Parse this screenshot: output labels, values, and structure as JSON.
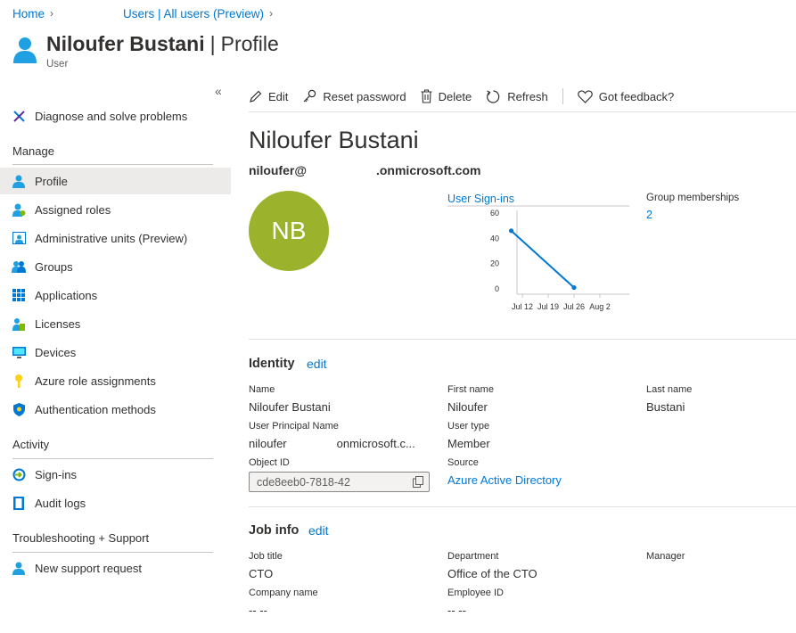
{
  "breadcrumb": [
    "Home",
    "Users | All users (Preview)"
  ],
  "header": {
    "name": "Niloufer Bustani",
    "page": "Profile",
    "subtitle": "User"
  },
  "sidebar": {
    "collapse_glyph": "«",
    "top_items": [
      {
        "label": "Diagnose and solve problems",
        "icon": "wrench-icon"
      }
    ],
    "sections": [
      {
        "title": "Manage",
        "items": [
          {
            "label": "Profile",
            "icon": "user-icon"
          },
          {
            "label": "Assigned roles",
            "icon": "assigned-roles-icon"
          },
          {
            "label": "Administrative units (Preview)",
            "icon": "admin-units-icon"
          },
          {
            "label": "Groups",
            "icon": "groups-icon"
          },
          {
            "label": "Applications",
            "icon": "grid-icon"
          },
          {
            "label": "Licenses",
            "icon": "license-icon"
          },
          {
            "label": "Devices",
            "icon": "monitor-icon"
          },
          {
            "label": "Azure role assignments",
            "icon": "key-icon"
          },
          {
            "label": "Authentication methods",
            "icon": "shield-icon"
          }
        ]
      },
      {
        "title": "Activity",
        "items": [
          {
            "label": "Sign-ins",
            "icon": "signin-icon"
          },
          {
            "label": "Audit logs",
            "icon": "book-icon"
          }
        ]
      },
      {
        "title": "Troubleshooting + Support",
        "items": [
          {
            "label": "New support request",
            "icon": "support-user-icon"
          }
        ]
      }
    ]
  },
  "toolbar": {
    "edit": "Edit",
    "reset_password": "Reset password",
    "delete": "Delete",
    "refresh": "Refresh",
    "feedback": "Got feedback?"
  },
  "profile": {
    "display_name": "Niloufer Bustani",
    "upn_prefix": "niloufer@",
    "upn_suffix": ".onmicrosoft.com",
    "initials": "NB",
    "avatar_color": "#9bb32c"
  },
  "signins_chart": {
    "title": "User Sign-ins",
    "chart_data": {
      "type": "line",
      "x_ticks": [
        "Jul 12",
        "Jul 19",
        "Jul 26",
        "Aug 2"
      ],
      "y_ticks": [
        0,
        20,
        40,
        60
      ],
      "ylim": [
        0,
        60
      ],
      "series": [
        {
          "points": [
            {
              "x": "Jul 9",
              "y": 46
            },
            {
              "x": "Jul 26",
              "y": 1
            }
          ]
        }
      ]
    },
    "line_color": "#0078d4"
  },
  "group_memberships": {
    "label": "Group memberships",
    "value": "2"
  },
  "identity": {
    "title": "Identity",
    "edit": "edit",
    "name_label": "Name",
    "name_value": "Niloufer Bustani",
    "first_label": "First name",
    "first_value": "Niloufer",
    "last_label": "Last name",
    "last_value": "Bustani",
    "upn_label": "User Principal Name",
    "upn_value_start": "niloufer",
    "upn_value_end": "onmicrosoft.c...",
    "type_label": "User type",
    "type_value": "Member",
    "objid_label": "Object ID",
    "objid_value": "cde8eeb0-7818-42",
    "source_label": "Source",
    "source_value": "Azure Active Directory"
  },
  "job": {
    "title": "Job info",
    "edit": "edit",
    "jobtitle_label": "Job title",
    "jobtitle_value": "CTO",
    "dept_label": "Department",
    "dept_value": "Office of the CTO",
    "manager_label": "Manager",
    "company_label": "Company name",
    "company_value": "-- --",
    "empid_label": "Employee ID",
    "empid_value": "-- --"
  }
}
